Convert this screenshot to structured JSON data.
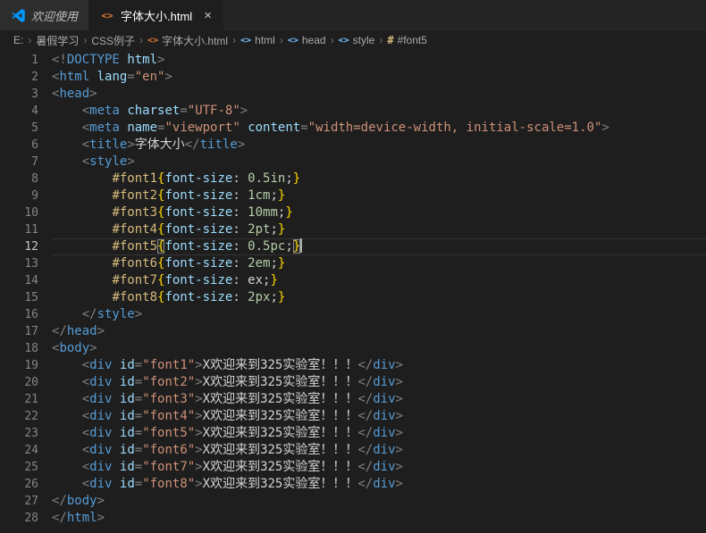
{
  "window": {
    "tabs": [
      {
        "id": "welcome",
        "label": "欢迎使用",
        "icon": "vscode-logo",
        "active": false,
        "italic": true
      },
      {
        "id": "file",
        "label": "字体大小.html",
        "icon": "html-file",
        "active": true,
        "close": "×"
      }
    ],
    "icons": {
      "html-file": "<>",
      "tag": "<>",
      "css-rule": "#",
      "vscode-logo": "vscode"
    },
    "breadcrumb": {
      "separator": "›",
      "items": [
        {
          "label": "E:"
        },
        {
          "label": "暑假学习"
        },
        {
          "label": "CSS例子"
        },
        {
          "label": "字体大小.html",
          "icon": "html-file"
        },
        {
          "label": "html",
          "icon": "tag"
        },
        {
          "label": "head",
          "icon": "tag"
        },
        {
          "label": "style",
          "icon": "tag"
        },
        {
          "label": "#font5",
          "icon": "css-rule"
        }
      ]
    }
  },
  "theme": {
    "editor_bg": "#1e1e1e",
    "tabbar_bg": "#252526",
    "inactive_tab_bg": "#2d2d2d",
    "tag_blue": "#569cd6",
    "attr_blue": "#9cdcfe",
    "string_orange": "#ce9178",
    "number_green": "#b5cea8",
    "selector_gold": "#d7ba7d",
    "brace_gold": "#ffd700",
    "line_number_gray": "#858585"
  },
  "editor": {
    "active_line": 12,
    "lines": [
      {
        "n": 1,
        "tokens": [
          {
            "t": "<!",
            "c": "pn"
          },
          {
            "t": "DOCTYPE",
            "c": "tg"
          },
          {
            "t": " ",
            "c": "tx"
          },
          {
            "t": "html",
            "c": "at"
          },
          {
            "t": ">",
            "c": "pn"
          }
        ]
      },
      {
        "n": 2,
        "tokens": [
          {
            "t": "<",
            "c": "pn"
          },
          {
            "t": "html",
            "c": "tg"
          },
          {
            "t": " ",
            "c": "tx"
          },
          {
            "t": "lang",
            "c": "at"
          },
          {
            "t": "=",
            "c": "pn"
          },
          {
            "t": "\"en\"",
            "c": "st"
          },
          {
            "t": ">",
            "c": "pn"
          }
        ]
      },
      {
        "n": 3,
        "tokens": [
          {
            "t": "<",
            "c": "pn"
          },
          {
            "t": "head",
            "c": "tg"
          },
          {
            "t": ">",
            "c": "pn"
          }
        ]
      },
      {
        "n": 4,
        "tokens": [
          {
            "t": "    ",
            "c": "tx"
          },
          {
            "t": "<",
            "c": "pn"
          },
          {
            "t": "meta",
            "c": "tg"
          },
          {
            "t": " ",
            "c": "tx"
          },
          {
            "t": "charset",
            "c": "at"
          },
          {
            "t": "=",
            "c": "pn"
          },
          {
            "t": "\"UTF-8\"",
            "c": "st"
          },
          {
            "t": ">",
            "c": "pn"
          }
        ]
      },
      {
        "n": 5,
        "tokens": [
          {
            "t": "    ",
            "c": "tx"
          },
          {
            "t": "<",
            "c": "pn"
          },
          {
            "t": "meta",
            "c": "tg"
          },
          {
            "t": " ",
            "c": "tx"
          },
          {
            "t": "name",
            "c": "at"
          },
          {
            "t": "=",
            "c": "pn"
          },
          {
            "t": "\"viewport\"",
            "c": "st"
          },
          {
            "t": " ",
            "c": "tx"
          },
          {
            "t": "content",
            "c": "at"
          },
          {
            "t": "=",
            "c": "pn"
          },
          {
            "t": "\"width=device-width, initial-scale=1.0\"",
            "c": "st"
          },
          {
            "t": ">",
            "c": "pn"
          }
        ]
      },
      {
        "n": 6,
        "tokens": [
          {
            "t": "    ",
            "c": "tx"
          },
          {
            "t": "<",
            "c": "pn"
          },
          {
            "t": "title",
            "c": "tg"
          },
          {
            "t": ">",
            "c": "pn"
          },
          {
            "t": "字体大小",
            "c": "tx"
          },
          {
            "t": "</",
            "c": "pn"
          },
          {
            "t": "title",
            "c": "tg"
          },
          {
            "t": ">",
            "c": "pn"
          }
        ]
      },
      {
        "n": 7,
        "tokens": [
          {
            "t": "    ",
            "c": "tx"
          },
          {
            "t": "<",
            "c": "pn"
          },
          {
            "t": "style",
            "c": "tg"
          },
          {
            "t": ">",
            "c": "pn"
          }
        ]
      },
      {
        "n": 8,
        "tokens": [
          {
            "t": "        ",
            "c": "tx"
          },
          {
            "t": "#font1",
            "c": "sel"
          },
          {
            "t": "{",
            "c": "br"
          },
          {
            "t": "font-size",
            "c": "at"
          },
          {
            "t": ": ",
            "c": "tx"
          },
          {
            "t": "0.5in",
            "c": "num"
          },
          {
            "t": ";",
            "c": "tx"
          },
          {
            "t": "}",
            "c": "br"
          }
        ]
      },
      {
        "n": 9,
        "tokens": [
          {
            "t": "        ",
            "c": "tx"
          },
          {
            "t": "#font2",
            "c": "sel"
          },
          {
            "t": "{",
            "c": "br"
          },
          {
            "t": "font-size",
            "c": "at"
          },
          {
            "t": ": ",
            "c": "tx"
          },
          {
            "t": "1cm",
            "c": "num"
          },
          {
            "t": ";",
            "c": "tx"
          },
          {
            "t": "}",
            "c": "br"
          }
        ]
      },
      {
        "n": 10,
        "tokens": [
          {
            "t": "        ",
            "c": "tx"
          },
          {
            "t": "#font3",
            "c": "sel"
          },
          {
            "t": "{",
            "c": "br"
          },
          {
            "t": "font-size",
            "c": "at"
          },
          {
            "t": ": ",
            "c": "tx"
          },
          {
            "t": "10mm",
            "c": "num"
          },
          {
            "t": ";",
            "c": "tx"
          },
          {
            "t": "}",
            "c": "br"
          }
        ]
      },
      {
        "n": 11,
        "tokens": [
          {
            "t": "        ",
            "c": "tx"
          },
          {
            "t": "#font4",
            "c": "sel"
          },
          {
            "t": "{",
            "c": "br"
          },
          {
            "t": "font-size",
            "c": "at"
          },
          {
            "t": ": ",
            "c": "tx"
          },
          {
            "t": "2pt",
            "c": "num"
          },
          {
            "t": ";",
            "c": "tx"
          },
          {
            "t": "}",
            "c": "br"
          }
        ]
      },
      {
        "n": 12,
        "tokens": [
          {
            "t": "        ",
            "c": "tx"
          },
          {
            "t": "#font5",
            "c": "sel"
          },
          {
            "t": "{",
            "c": "br",
            "m": true
          },
          {
            "t": "font-size",
            "c": "at"
          },
          {
            "t": ": ",
            "c": "tx"
          },
          {
            "t": "0.5pc",
            "c": "num"
          },
          {
            "t": ";",
            "c": "tx"
          },
          {
            "t": "}",
            "c": "br",
            "m": true
          },
          {
            "cursor": true
          }
        ]
      },
      {
        "n": 13,
        "tokens": [
          {
            "t": "        ",
            "c": "tx"
          },
          {
            "t": "#font6",
            "c": "sel"
          },
          {
            "t": "{",
            "c": "br"
          },
          {
            "t": "font-size",
            "c": "at"
          },
          {
            "t": ": ",
            "c": "tx"
          },
          {
            "t": "2em",
            "c": "num"
          },
          {
            "t": ";",
            "c": "tx"
          },
          {
            "t": "}",
            "c": "br"
          }
        ]
      },
      {
        "n": 14,
        "tokens": [
          {
            "t": "        ",
            "c": "tx"
          },
          {
            "t": "#font7",
            "c": "sel"
          },
          {
            "t": "{",
            "c": "br"
          },
          {
            "t": "font-size",
            "c": "at"
          },
          {
            "t": ": ",
            "c": "tx"
          },
          {
            "t": "ex",
            "c": "tx"
          },
          {
            "t": ";",
            "c": "tx"
          },
          {
            "t": "}",
            "c": "br"
          }
        ]
      },
      {
        "n": 15,
        "tokens": [
          {
            "t": "        ",
            "c": "tx"
          },
          {
            "t": "#font8",
            "c": "sel"
          },
          {
            "t": "{",
            "c": "br"
          },
          {
            "t": "font-size",
            "c": "at"
          },
          {
            "t": ": ",
            "c": "tx"
          },
          {
            "t": "2px",
            "c": "num"
          },
          {
            "t": ";",
            "c": "tx"
          },
          {
            "t": "}",
            "c": "br"
          }
        ]
      },
      {
        "n": 16,
        "tokens": [
          {
            "t": "    ",
            "c": "tx"
          },
          {
            "t": "</",
            "c": "pn"
          },
          {
            "t": "style",
            "c": "tg"
          },
          {
            "t": ">",
            "c": "pn"
          }
        ]
      },
      {
        "n": 17,
        "tokens": [
          {
            "t": "</",
            "c": "pn"
          },
          {
            "t": "head",
            "c": "tg"
          },
          {
            "t": ">",
            "c": "pn"
          }
        ]
      },
      {
        "n": 18,
        "tokens": [
          {
            "t": "<",
            "c": "pn"
          },
          {
            "t": "body",
            "c": "tg"
          },
          {
            "t": ">",
            "c": "pn"
          }
        ]
      },
      {
        "n": 19,
        "tokens": [
          {
            "t": "    ",
            "c": "tx"
          },
          {
            "t": "<",
            "c": "pn"
          },
          {
            "t": "div",
            "c": "tg"
          },
          {
            "t": " ",
            "c": "tx"
          },
          {
            "t": "id",
            "c": "at"
          },
          {
            "t": "=",
            "c": "pn"
          },
          {
            "t": "\"font1\"",
            "c": "st"
          },
          {
            "t": ">",
            "c": "pn"
          },
          {
            "t": "X欢迎来到325实验室！！！",
            "c": "tx"
          },
          {
            "t": "</",
            "c": "pn"
          },
          {
            "t": "div",
            "c": "tg"
          },
          {
            "t": ">",
            "c": "pn"
          }
        ]
      },
      {
        "n": 20,
        "tokens": [
          {
            "t": "    ",
            "c": "tx"
          },
          {
            "t": "<",
            "c": "pn"
          },
          {
            "t": "div",
            "c": "tg"
          },
          {
            "t": " ",
            "c": "tx"
          },
          {
            "t": "id",
            "c": "at"
          },
          {
            "t": "=",
            "c": "pn"
          },
          {
            "t": "\"font2\"",
            "c": "st"
          },
          {
            "t": ">",
            "c": "pn"
          },
          {
            "t": "X欢迎来到325实验室！！！",
            "c": "tx"
          },
          {
            "t": "</",
            "c": "pn"
          },
          {
            "t": "div",
            "c": "tg"
          },
          {
            "t": ">",
            "c": "pn"
          }
        ]
      },
      {
        "n": 21,
        "tokens": [
          {
            "t": "    ",
            "c": "tx"
          },
          {
            "t": "<",
            "c": "pn"
          },
          {
            "t": "div",
            "c": "tg"
          },
          {
            "t": " ",
            "c": "tx"
          },
          {
            "t": "id",
            "c": "at"
          },
          {
            "t": "=",
            "c": "pn"
          },
          {
            "t": "\"font3\"",
            "c": "st"
          },
          {
            "t": ">",
            "c": "pn"
          },
          {
            "t": "X欢迎来到325实验室！！！",
            "c": "tx"
          },
          {
            "t": "</",
            "c": "pn"
          },
          {
            "t": "div",
            "c": "tg"
          },
          {
            "t": ">",
            "c": "pn"
          }
        ]
      },
      {
        "n": 22,
        "tokens": [
          {
            "t": "    ",
            "c": "tx"
          },
          {
            "t": "<",
            "c": "pn"
          },
          {
            "t": "div",
            "c": "tg"
          },
          {
            "t": " ",
            "c": "tx"
          },
          {
            "t": "id",
            "c": "at"
          },
          {
            "t": "=",
            "c": "pn"
          },
          {
            "t": "\"font4\"",
            "c": "st"
          },
          {
            "t": ">",
            "c": "pn"
          },
          {
            "t": "X欢迎来到325实验室！！！",
            "c": "tx"
          },
          {
            "t": "</",
            "c": "pn"
          },
          {
            "t": "div",
            "c": "tg"
          },
          {
            "t": ">",
            "c": "pn"
          }
        ]
      },
      {
        "n": 23,
        "tokens": [
          {
            "t": "    ",
            "c": "tx"
          },
          {
            "t": "<",
            "c": "pn"
          },
          {
            "t": "div",
            "c": "tg"
          },
          {
            "t": " ",
            "c": "tx"
          },
          {
            "t": "id",
            "c": "at"
          },
          {
            "t": "=",
            "c": "pn"
          },
          {
            "t": "\"font5\"",
            "c": "st"
          },
          {
            "t": ">",
            "c": "pn"
          },
          {
            "t": "X欢迎来到325实验室！！！",
            "c": "tx"
          },
          {
            "t": "</",
            "c": "pn"
          },
          {
            "t": "div",
            "c": "tg"
          },
          {
            "t": ">",
            "c": "pn"
          }
        ]
      },
      {
        "n": 24,
        "tokens": [
          {
            "t": "    ",
            "c": "tx"
          },
          {
            "t": "<",
            "c": "pn"
          },
          {
            "t": "div",
            "c": "tg"
          },
          {
            "t": " ",
            "c": "tx"
          },
          {
            "t": "id",
            "c": "at"
          },
          {
            "t": "=",
            "c": "pn"
          },
          {
            "t": "\"font6\"",
            "c": "st"
          },
          {
            "t": ">",
            "c": "pn"
          },
          {
            "t": "X欢迎来到325实验室！！！",
            "c": "tx"
          },
          {
            "t": "</",
            "c": "pn"
          },
          {
            "t": "div",
            "c": "tg"
          },
          {
            "t": ">",
            "c": "pn"
          }
        ]
      },
      {
        "n": 25,
        "tokens": [
          {
            "t": "    ",
            "c": "tx"
          },
          {
            "t": "<",
            "c": "pn"
          },
          {
            "t": "div",
            "c": "tg"
          },
          {
            "t": " ",
            "c": "tx"
          },
          {
            "t": "id",
            "c": "at"
          },
          {
            "t": "=",
            "c": "pn"
          },
          {
            "t": "\"font7\"",
            "c": "st"
          },
          {
            "t": ">",
            "c": "pn"
          },
          {
            "t": "X欢迎来到325实验室！！！",
            "c": "tx"
          },
          {
            "t": "</",
            "c": "pn"
          },
          {
            "t": "div",
            "c": "tg"
          },
          {
            "t": ">",
            "c": "pn"
          }
        ]
      },
      {
        "n": 26,
        "tokens": [
          {
            "t": "    ",
            "c": "tx"
          },
          {
            "t": "<",
            "c": "pn"
          },
          {
            "t": "div",
            "c": "tg"
          },
          {
            "t": " ",
            "c": "tx"
          },
          {
            "t": "id",
            "c": "at"
          },
          {
            "t": "=",
            "c": "pn"
          },
          {
            "t": "\"font8\"",
            "c": "st"
          },
          {
            "t": ">",
            "c": "pn"
          },
          {
            "t": "X欢迎来到325实验室！！！",
            "c": "tx"
          },
          {
            "t": "</",
            "c": "pn"
          },
          {
            "t": "div",
            "c": "tg"
          },
          {
            "t": ">",
            "c": "pn"
          }
        ]
      },
      {
        "n": 27,
        "tokens": [
          {
            "t": "</",
            "c": "pn"
          },
          {
            "t": "body",
            "c": "tg"
          },
          {
            "t": ">",
            "c": "pn"
          }
        ]
      },
      {
        "n": 28,
        "tokens": [
          {
            "t": "</",
            "c": "pn"
          },
          {
            "t": "html",
            "c": "tg"
          },
          {
            "t": ">",
            "c": "pn"
          }
        ]
      }
    ]
  }
}
